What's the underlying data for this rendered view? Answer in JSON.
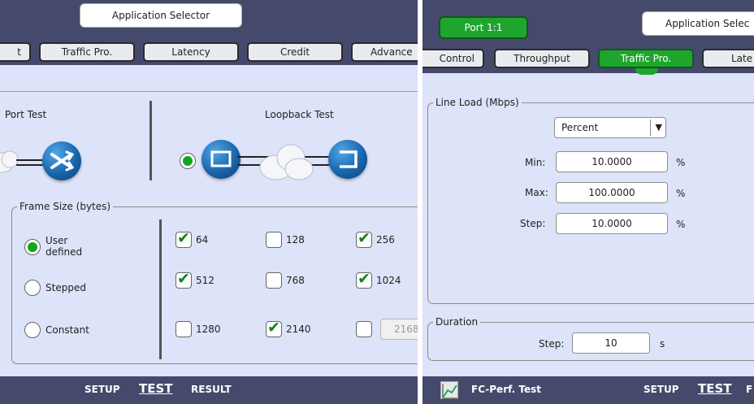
{
  "left": {
    "app_selector": "Application Selector",
    "tabs": [
      {
        "label": "t"
      },
      {
        "label": "Traffic Pro."
      },
      {
        "label": "Latency"
      },
      {
        "label": "Credit"
      },
      {
        "label": "Advance"
      }
    ],
    "port_test_label": "Port Test",
    "loopback_test_label": "Loopback Test",
    "frame_size": {
      "legend": "Frame Size (bytes)",
      "modes": [
        {
          "label": "User\ndefined",
          "selected": true
        },
        {
          "label": "Stepped",
          "selected": false
        },
        {
          "label": "Constant",
          "selected": false
        }
      ],
      "sizes": [
        {
          "label": "64",
          "checked": true
        },
        {
          "label": "128",
          "checked": false
        },
        {
          "label": "256",
          "checked": true
        },
        {
          "label": "512",
          "checked": true
        },
        {
          "label": "768",
          "checked": false
        },
        {
          "label": "1024",
          "checked": true
        },
        {
          "label": "1280",
          "checked": false
        },
        {
          "label": "2140",
          "checked": true
        },
        {
          "label": "",
          "checked": false
        }
      ],
      "custom_value": "2168"
    },
    "bottom_nav": {
      "setup": "SETUP",
      "test": "TEST",
      "result": "RESULT"
    }
  },
  "right": {
    "port_button": "Port 1:1",
    "app_selector": "Application Selec",
    "tabs": [
      {
        "label": "Control"
      },
      {
        "label": "Throughput"
      },
      {
        "label": "Traffic Pro."
      },
      {
        "label": "Late"
      }
    ],
    "line_load": {
      "legend": "Line Load (Mbps)",
      "unit_select": "Percent",
      "min_label": "Min:",
      "min_value": "10.0000",
      "max_label": "Max:",
      "max_value": "100.0000",
      "step_label": "Step:",
      "step_value": "10.0000",
      "unit": "%"
    },
    "duration": {
      "legend": "Duration",
      "step_label": "Step:",
      "step_value": "10",
      "unit": "s"
    },
    "bottom": {
      "test_name": "FC-Perf. Test",
      "setup": "SETUP",
      "test": "TEST",
      "f": "F"
    }
  },
  "colors": {
    "bar": "#45496c",
    "panel": "#dde3f8",
    "active_tab": "#1fa52e",
    "radio_on": "#13a51c"
  }
}
